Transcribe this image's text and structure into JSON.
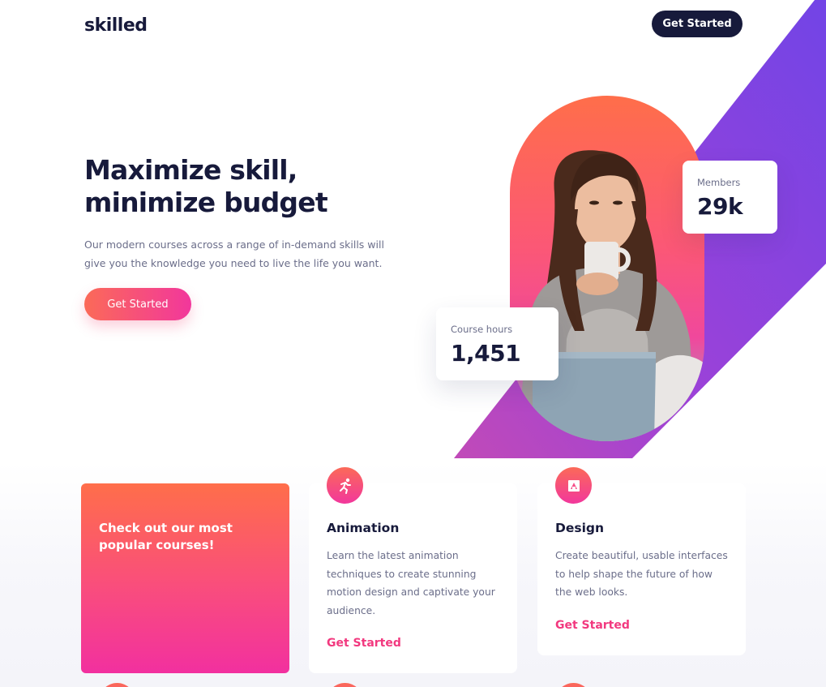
{
  "header": {
    "logo": "skilled",
    "cta_label": "Get Started"
  },
  "hero": {
    "title_line1": "Maximize skill,",
    "title_line2": "minimize budget",
    "description": "Our modern courses across a range of in-demand skills will give you the knowledge you need to live the life you want.",
    "cta_label": "Get Started"
  },
  "stats": {
    "members": {
      "label": "Members",
      "value": "29k"
    },
    "course_hours": {
      "label": "Course hours",
      "value": "1,451"
    }
  },
  "promo": {
    "text": "Check out our most popular courses!"
  },
  "courses": [
    {
      "icon": "running-person-icon",
      "title": "Animation",
      "description": "Learn the latest animation techniques to create stunning motion design and captivate your audience.",
      "link_label": "Get Started"
    },
    {
      "icon": "design-frame-icon",
      "title": "Design",
      "description": "Create beautiful, usable interfaces to help shape the future of how the web looks.",
      "link_label": "Get Started"
    }
  ],
  "colors": {
    "navy": "#171a3b",
    "accent_orange": "#ff6e4a",
    "accent_pink": "#f2379c",
    "stripe_purple": "#7a4be8",
    "text_muted": "#6b6e8a",
    "link_pink": "#f2397f"
  }
}
